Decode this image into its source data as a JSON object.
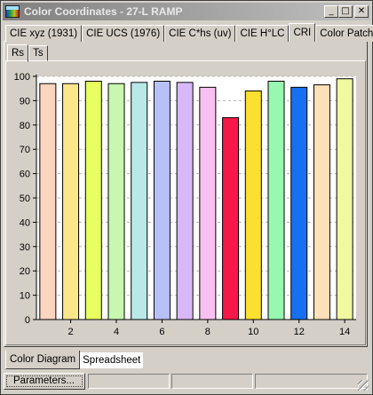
{
  "window": {
    "title": "Color Coordinates - 27-L RAMP",
    "minimize_glyph": "_",
    "maximize_glyph": "□",
    "close_glyph": "✕"
  },
  "tabs": [
    {
      "label": "CIE xyz (1931)"
    },
    {
      "label": "CIE UCS (1976)"
    },
    {
      "label": "CIE C*hs (uv)"
    },
    {
      "label": "CIE H°LC"
    },
    {
      "label": "CRI"
    },
    {
      "label": "Color Patch"
    }
  ],
  "active_tab": "CRI",
  "subtabs": [
    {
      "label": "Rs"
    },
    {
      "label": "Ts"
    }
  ],
  "bottom_tabs": [
    {
      "label": "Color Diagram"
    },
    {
      "label": "Spreadsheet"
    }
  ],
  "statusbar": {
    "parameters_button": "Parameters..."
  },
  "chart_data": {
    "type": "bar",
    "categories": [
      1,
      2,
      3,
      4,
      5,
      6,
      7,
      8,
      9,
      10,
      11,
      12,
      13,
      14
    ],
    "values": [
      97,
      97,
      98,
      97,
      97.5,
      98,
      97.5,
      95.5,
      83,
      94,
      98,
      95.5,
      96.5,
      99
    ],
    "colors": [
      "#fcd5c0",
      "#fce68c",
      "#e8ff60",
      "#c8f8b0",
      "#b8e8e8",
      "#b8c0f8",
      "#d8b8f8",
      "#f8c0f0",
      "#f81848",
      "#fce030",
      "#98f8b0",
      "#1870f0",
      "#fce0b8",
      "#f0f8a0"
    ],
    "x_tick_labels": [
      "2",
      "4",
      "6",
      "8",
      "10",
      "12",
      "14"
    ],
    "y_tick_labels": [
      "0",
      "10",
      "20",
      "30",
      "40",
      "50",
      "60",
      "70",
      "80",
      "90",
      "100"
    ],
    "ylim": [
      0,
      100
    ],
    "grid": true
  }
}
